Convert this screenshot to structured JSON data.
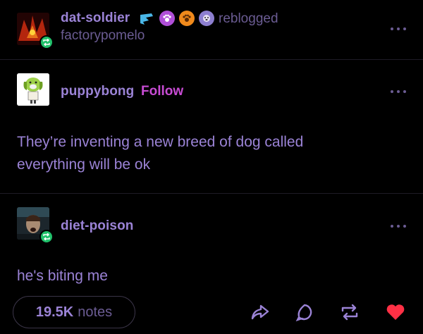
{
  "header": {
    "reblogger": "dat-soldier",
    "reblogged_label": "reblogged",
    "source": "factorypomelo",
    "badges": [
      "blue-badge-icon",
      "paw-badge-icon",
      "paw-orange-badge-icon",
      "dog-face-badge-icon"
    ]
  },
  "posts": [
    {
      "author": "puppybong",
      "follow_label": "Follow",
      "text": "They’re inventing a new breed of dog called everything will be ok"
    },
    {
      "author": "diet-poison",
      "text": "he's biting me"
    }
  ],
  "footer": {
    "notes_count": "19.5K",
    "notes_label": "notes",
    "actions": [
      "share-icon",
      "reply-icon",
      "reblog-icon",
      "like-icon"
    ]
  },
  "colors": {
    "text": "#9b83d6",
    "muted": "#6b5c93",
    "follow": "#c84cd4",
    "reblog_green": "#21c16b",
    "like_red": "#ff3045"
  }
}
